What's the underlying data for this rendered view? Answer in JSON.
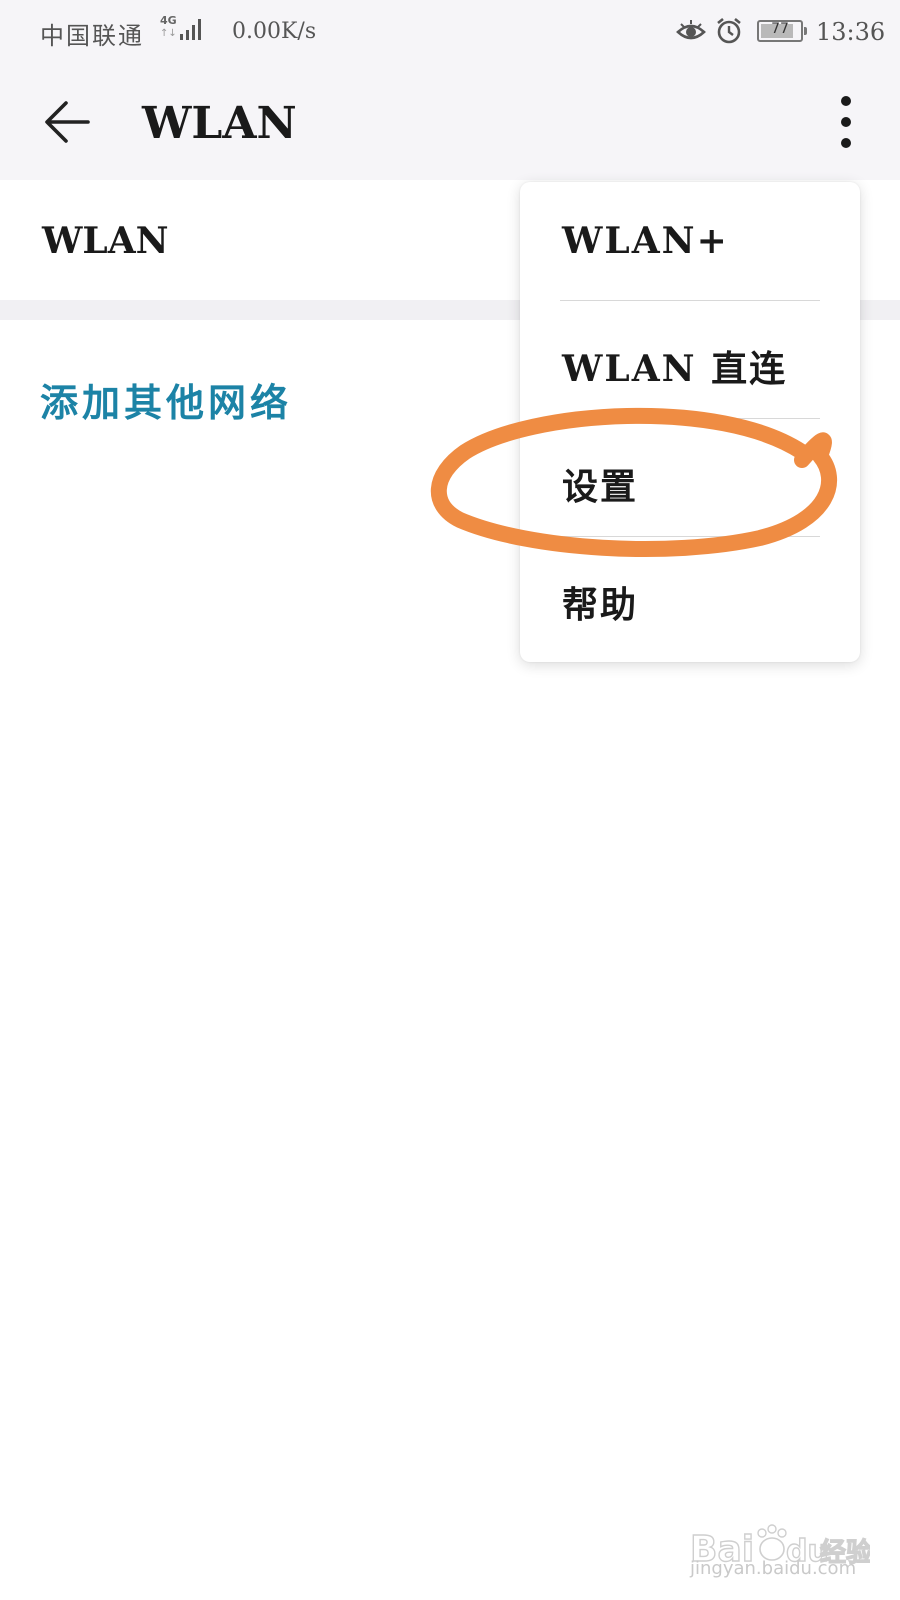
{
  "status_bar": {
    "carrier": "中国联通",
    "network_type": "4G",
    "network_speed": "0.00K/s",
    "battery_level": "77",
    "time": "13:36",
    "icons": [
      "signal-icon",
      "eye-icon",
      "alarm-icon",
      "battery-icon"
    ]
  },
  "app_bar": {
    "title": "WLAN",
    "back_icon": "arrow-left-icon",
    "more_icon": "more-vertical-icon"
  },
  "main": {
    "wlan_toggle_label": "WLAN",
    "add_network_label": "添加其他网络",
    "accent_color": "#1c83a6"
  },
  "overflow_menu": {
    "items": [
      {
        "label": "WLAN+"
      },
      {
        "label": "WLAN 直连"
      },
      {
        "label": "设置"
      },
      {
        "label": "帮助"
      }
    ]
  },
  "annotation": {
    "highlight_color": "#ef8c43",
    "highlighted_item": "设置"
  },
  "watermark": {
    "logo_text": "Bai",
    "logo_text2": "du",
    "brand": "经验",
    "url": "jingyan.baidu.com"
  }
}
